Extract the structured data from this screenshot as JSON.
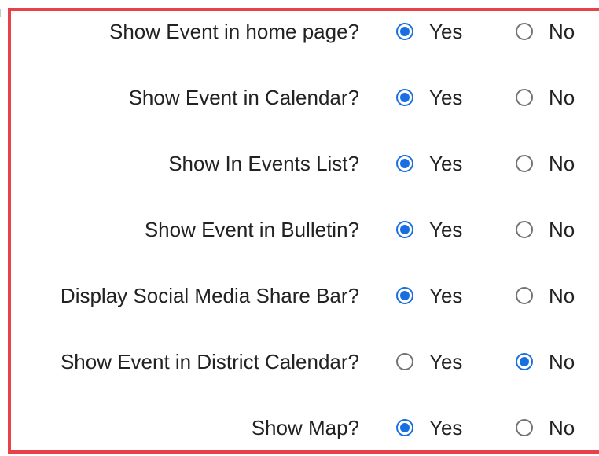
{
  "settings": [
    {
      "question": "Show Event in home page?",
      "yes_label": "Yes",
      "no_label": "No",
      "selected": "yes"
    },
    {
      "question": "Show Event in Calendar?",
      "yes_label": "Yes",
      "no_label": "No",
      "selected": "yes"
    },
    {
      "question": "Show In Events List?",
      "yes_label": "Yes",
      "no_label": "No",
      "selected": "yes"
    },
    {
      "question": "Show Event in Bulletin?",
      "yes_label": "Yes",
      "no_label": "No",
      "selected": "yes"
    },
    {
      "question": "Display Social Media Share Bar?",
      "yes_label": "Yes",
      "no_label": "No",
      "selected": "yes"
    },
    {
      "question": "Show Event in District Calendar?",
      "yes_label": "Yes",
      "no_label": "No",
      "selected": "no"
    },
    {
      "question": "Show Map?",
      "yes_label": "Yes",
      "no_label": "No",
      "selected": "yes"
    }
  ],
  "colors": {
    "frame_border": "#e8414b",
    "radio_checked": "#1a6fe0",
    "radio_unchecked": "#737373",
    "text": "#222222"
  }
}
